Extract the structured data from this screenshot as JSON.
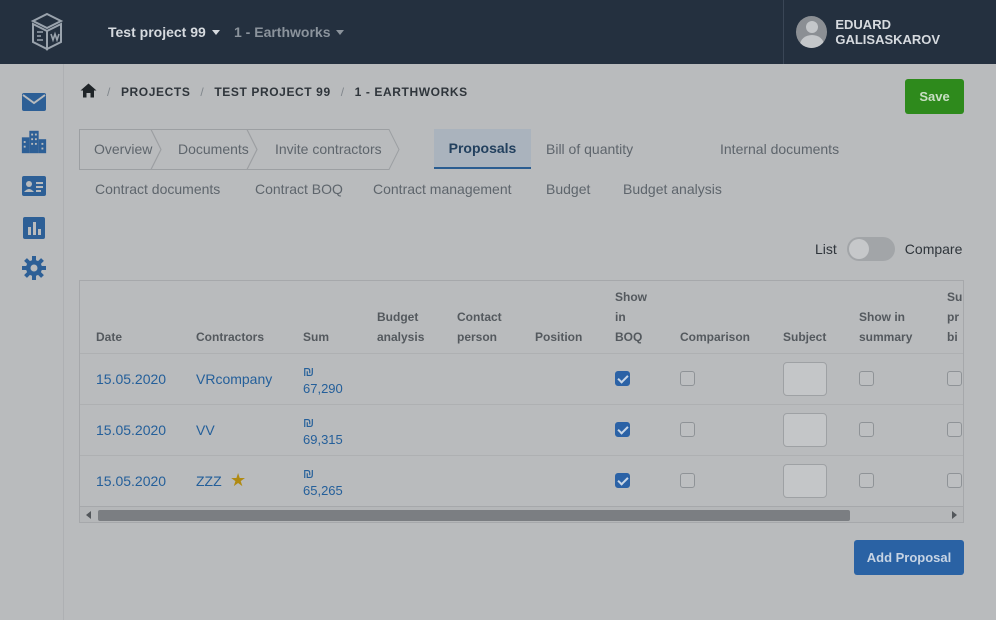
{
  "header": {
    "project_selector": "Test project 99",
    "stage_selector": "1 - Earthworks",
    "user_name": "EDUARD GALISASKAROV"
  },
  "sidebar": {
    "items": [
      {
        "icon": "envelope-icon"
      },
      {
        "icon": "buildings-icon"
      },
      {
        "icon": "contact-card-icon"
      },
      {
        "icon": "bar-chart-icon"
      },
      {
        "icon": "gear-icon"
      }
    ]
  },
  "breadcrumb": {
    "items": [
      "PROJECTS",
      "TEST PROJECT 99",
      "1 - EARTHWORKS"
    ]
  },
  "actions": {
    "save_label": "Save",
    "add_proposal_label": "Add Proposal"
  },
  "tabs": {
    "overview": "Overview",
    "documents": "Documents",
    "invite_contractors": "Invite contractors",
    "proposals": "Proposals",
    "bill_of_quantity": "Bill of quantity",
    "internal_documents": "Internal documents",
    "contract_documents": "Contract documents",
    "contract_boq": "Contract BOQ",
    "contract_management": "Contract management",
    "budget": "Budget",
    "budget_analysis": "Budget analysis",
    "active": "Proposals"
  },
  "view_toggle": {
    "left_label": "List",
    "right_label": "Compare",
    "compare_on": false
  },
  "table": {
    "headers": {
      "date": "Date",
      "contractors": "Contractors",
      "sum": "Sum",
      "budget_analysis_1": "Budget",
      "budget_analysis_2": "analysis",
      "contact_person_1": "Contact",
      "contact_person_2": "person",
      "position": "Position",
      "show_in_boq_1": "Show",
      "show_in_boq_2": "in",
      "show_in_boq_3": "BOQ",
      "comparison": "Comparison",
      "subject": "Subject",
      "show_in_summary_1": "Show in",
      "show_in_summary_2": "summary",
      "submitted_1": "Su",
      "submitted_2": "pr",
      "submitted_3": "bi"
    },
    "currency_symbol": "₪",
    "rows": [
      {
        "date": "15.05.2020",
        "contractor": "VRcompany",
        "sum": "67,290",
        "starred": false,
        "show_in_boq": true,
        "comparison": false,
        "show_in_summary": false,
        "submitted": false
      },
      {
        "date": "15.05.2020",
        "contractor": "VV",
        "sum": "69,315",
        "starred": false,
        "show_in_boq": true,
        "comparison": false,
        "show_in_summary": false,
        "submitted": false
      },
      {
        "date": "15.05.2020",
        "contractor": "ZZZ",
        "sum": "65,265",
        "starred": true,
        "show_in_boq": true,
        "comparison": false,
        "show_in_summary": false,
        "submitted": false
      }
    ]
  },
  "colors": {
    "topbar": "#24303f",
    "accent_blue": "#2a62a4",
    "save_green": "#2e8a1c",
    "star": "#b08a12"
  }
}
